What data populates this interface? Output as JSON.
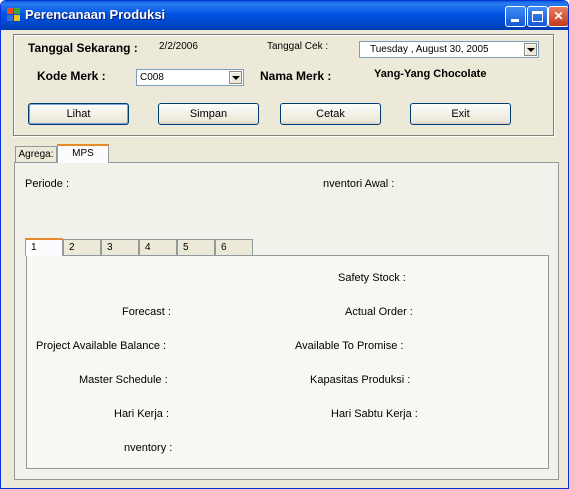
{
  "window": {
    "title": "Perencanaan Produksi",
    "min_label": "",
    "max_label": "",
    "close_label": "✕"
  },
  "header": {
    "tanggal_sekarang_label": "Tanggal Sekarang :",
    "tanggal_sekarang_value": "2/2/2006",
    "tanggal_cek_label": "Tanggal Cek :",
    "tanggal_cek_value": "Tuesday  ,    August   30, 2005",
    "kode_merk_label": "Kode Merk  :",
    "kode_merk_value": "C008",
    "nama_merk_label": "Nama Merk  :",
    "nama_merk_value": "Yang-Yang Chocolate"
  },
  "buttons": {
    "lihat": "Lihat",
    "simpan": "Simpan",
    "cetak": "Cetak",
    "exit": "Exit"
  },
  "tabs": [
    {
      "label": "Agrega:"
    },
    {
      "label": "MPS"
    }
  ],
  "mps": {
    "periode_label": "Periode :",
    "inventori_awal_label": "nventori Awal :"
  },
  "period_tabs": [
    {
      "label": "1"
    },
    {
      "label": "2"
    },
    {
      "label": "3"
    },
    {
      "label": "4"
    },
    {
      "label": "5"
    },
    {
      "label": "6"
    }
  ],
  "period_fields": {
    "safety_stock": "Safety Stock  :",
    "forecast": "Forecast :",
    "actual_order": "Actual Order :",
    "project_available_balance": "Project Available Balance :",
    "available_to_promise": "Available To Promise :",
    "master_schedule": "Master Schedule :",
    "kapasitas_produksi": "Kapasitas Produksi :",
    "hari_kerja": "Hari Kerja :",
    "hari_sabtu_kerja": "Hari Sabtu Kerja :",
    "inventory": "nventory :"
  },
  "colors": {
    "titlebar": "#0054e3",
    "face": "#ece9d8",
    "tab_highlight": "#e68b2c"
  }
}
